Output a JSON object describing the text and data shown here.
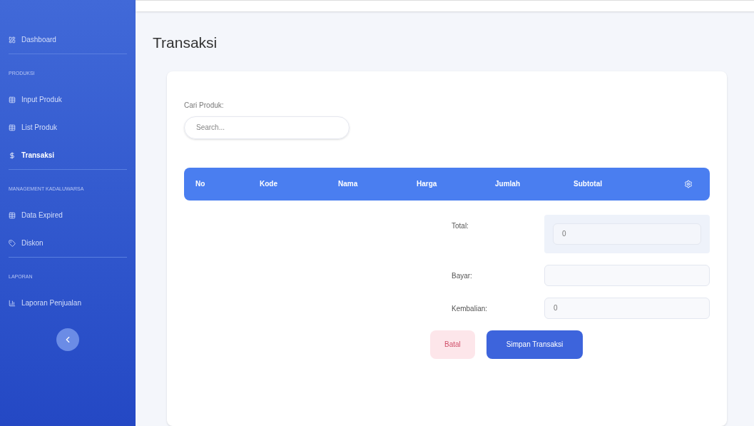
{
  "sidebar": {
    "items": [
      {
        "kind": "link",
        "label": "Dashboard",
        "selected": false
      },
      {
        "kind": "heading",
        "label": "PRODUKSI"
      },
      {
        "kind": "link",
        "label": "Input Produk",
        "selected": false
      },
      {
        "kind": "link",
        "label": "List Produk",
        "selected": false
      },
      {
        "kind": "link",
        "label": "Transaksi",
        "selected": true
      },
      {
        "kind": "heading",
        "label": "MANAGEMENT KADALUWARSA"
      },
      {
        "kind": "link",
        "label": "Data Expired",
        "selected": false
      },
      {
        "kind": "link",
        "label": "Diskon",
        "selected": false
      },
      {
        "kind": "heading",
        "label": "LAPORAN"
      },
      {
        "kind": "link",
        "label": "Laporan Penjualan",
        "selected": false
      }
    ]
  },
  "page": {
    "title": "Transaksi"
  },
  "search": {
    "label": "Cari Produk:",
    "placeholder": "Search..."
  },
  "table": {
    "columns": [
      "No",
      "Kode",
      "Nama",
      "Harga",
      "Jumlah",
      "Subtotal"
    ]
  },
  "summary": [
    {
      "kind": "total",
      "label": "Total:",
      "value": "0"
    },
    {
      "kind": "field",
      "label": "Bayar:"
    },
    {
      "kind": "field",
      "label": "Kembalian:",
      "value": "0"
    }
  ],
  "buttons": [
    {
      "kind": "cancel",
      "label": "Batal"
    },
    {
      "kind": "primary",
      "label": "Simpan Transaksi"
    }
  ]
}
